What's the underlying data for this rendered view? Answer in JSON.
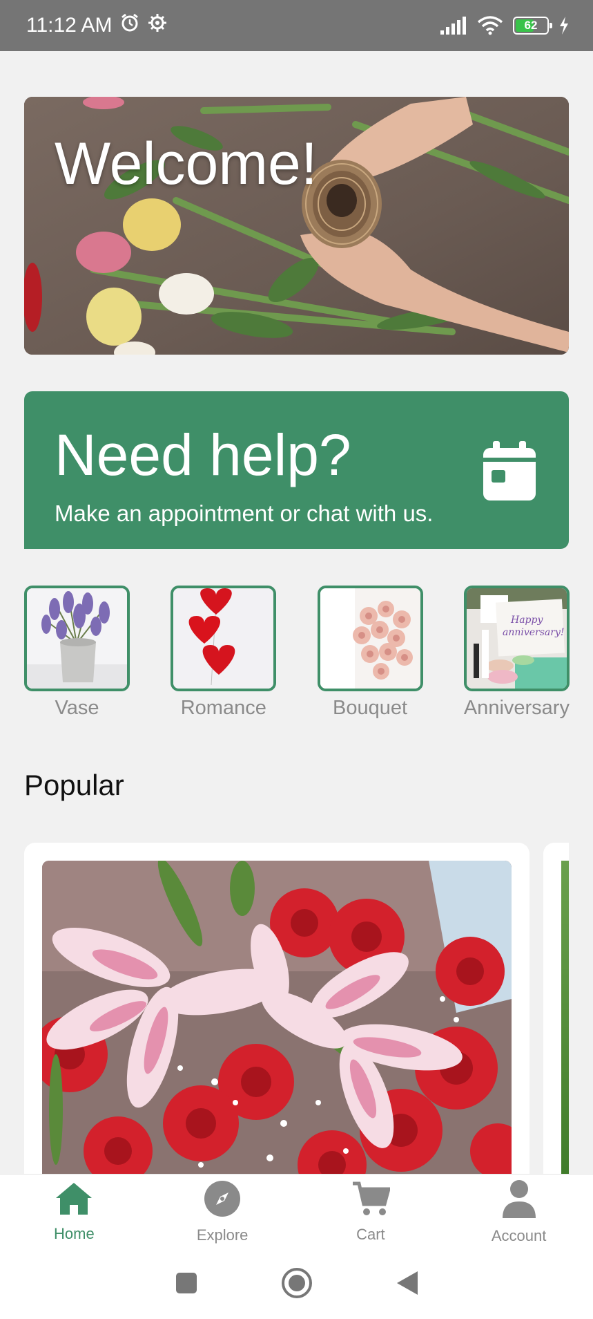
{
  "status_bar": {
    "time": "11:12 AM",
    "battery": "62",
    "battery_level": 0.62,
    "icons": [
      "alarm-icon",
      "settings-icon",
      "signal-icon",
      "wifi-icon",
      "battery-icon",
      "charging-icon"
    ]
  },
  "banner": {
    "title": "Welcome!"
  },
  "help": {
    "title": "Need help?",
    "subtitle": "Make an appointment or chat with us.",
    "icon": "calendar-icon"
  },
  "categories": [
    {
      "label": "Vase"
    },
    {
      "label": "Romance"
    },
    {
      "label": "Bouquet"
    },
    {
      "label": "Anniversary"
    }
  ],
  "anniversary_card_text": "Happy anniversary!",
  "popular": {
    "title": "Popular"
  },
  "nav": {
    "items": [
      {
        "label": "Home",
        "icon": "home-icon",
        "active": true
      },
      {
        "label": "Explore",
        "icon": "compass-icon",
        "active": false
      },
      {
        "label": "Cart",
        "icon": "cart-icon",
        "active": false
      },
      {
        "label": "Account",
        "icon": "account-icon",
        "active": false
      }
    ]
  },
  "colors": {
    "accent": "#3f8f68",
    "background": "#f1f1f1",
    "status_bar": "#757575",
    "inactive": "#8a8a8a"
  }
}
